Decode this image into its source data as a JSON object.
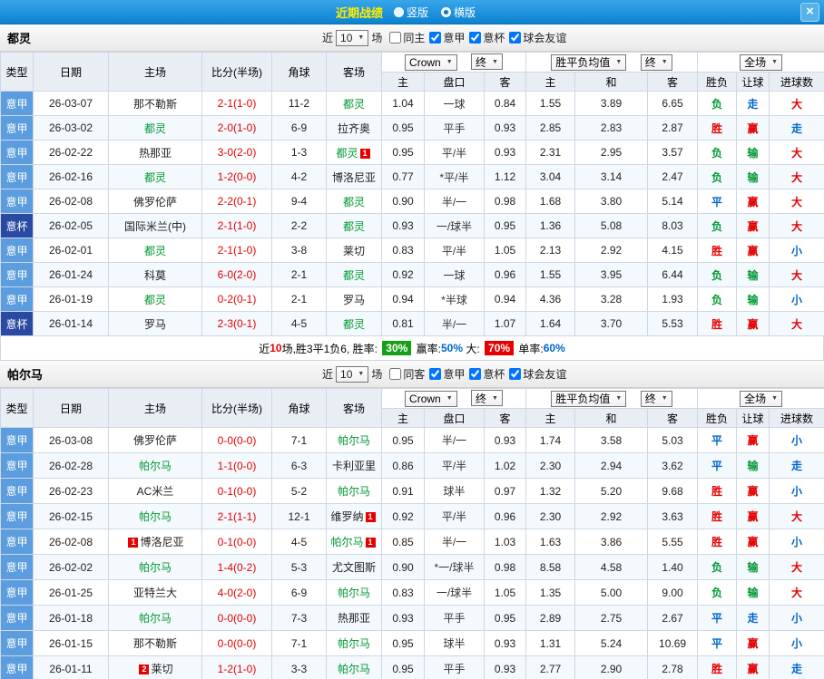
{
  "topbar": {
    "title": "近期战绩",
    "layout_options": [
      {
        "label": "竖版",
        "selected": false
      },
      {
        "label": "横版",
        "selected": true
      }
    ]
  },
  "icons": {
    "chevron_down": "▼",
    "close": "×"
  },
  "colors": {
    "league": {
      "意甲": "#5b9dde",
      "意杯": "#2a49a5"
    },
    "results": {
      "胜": "#e60000",
      "平": "#0066cc",
      "负": "#009933",
      "赢": "#e60000",
      "输": "#009933",
      "走": "#0066cc",
      "大": "#e60000",
      "小": "#0066cc"
    }
  },
  "table_headers": {
    "type": "类型",
    "date": "日期",
    "home": "主场",
    "score": "比分(半场)",
    "corner": "角球",
    "away": "客场",
    "odds_home": "主",
    "handicap": "盘口",
    "odds_away": "客",
    "avg_home": "主",
    "avg_draw": "和",
    "avg_away": "客",
    "result": "胜负",
    "handicap_result": "让球",
    "goals": "进球数",
    "bookmaker_select": "Crown",
    "final_select": "终",
    "avg_select": "胜平负均值",
    "scope_select": "全场"
  },
  "sections": [
    {
      "team": "都灵",
      "filter": {
        "recent_label": "近",
        "count": "10",
        "games_label": "场",
        "checkboxes": [
          {
            "label": "同主",
            "checked": false
          },
          {
            "label": "意甲",
            "checked": true
          },
          {
            "label": "意杯",
            "checked": true
          },
          {
            "label": "球会友谊",
            "checked": true
          }
        ]
      },
      "rows": [
        {
          "type": "意甲",
          "date": "26-03-07",
          "home": "那不勒斯",
          "score": "2-1(1-0)",
          "corner": "11-2",
          "away": "都灵",
          "odds": [
            "1.04",
            "一球",
            "0.84"
          ],
          "avg": [
            "1.55",
            "3.89",
            "6.65"
          ],
          "results": [
            "负",
            "走",
            "大"
          ]
        },
        {
          "type": "意甲",
          "date": "26-03-02",
          "home": "都灵",
          "score": "2-0(1-0)",
          "corner": "6-9",
          "away": "拉齐奥",
          "odds": [
            "0.95",
            "平手",
            "0.93"
          ],
          "avg": [
            "2.85",
            "2.83",
            "2.87"
          ],
          "results": [
            "胜",
            "赢",
            "走"
          ]
        },
        {
          "type": "意甲",
          "date": "26-02-22",
          "home": "热那亚",
          "score": "3-0(2-0)",
          "corner": "1-3",
          "away": "都灵",
          "away_card": "1",
          "odds": [
            "0.95",
            "平/半",
            "0.93"
          ],
          "avg": [
            "2.31",
            "2.95",
            "3.57"
          ],
          "results": [
            "负",
            "输",
            "大"
          ]
        },
        {
          "type": "意甲",
          "date": "26-02-16",
          "home": "都灵",
          "score": "1-2(0-0)",
          "corner": "4-2",
          "away": "博洛尼亚",
          "odds": [
            "0.77",
            "*平/半",
            "1.12"
          ],
          "avg": [
            "3.04",
            "3.14",
            "2.47"
          ],
          "results": [
            "负",
            "输",
            "大"
          ]
        },
        {
          "type": "意甲",
          "date": "26-02-08",
          "home": "佛罗伦萨",
          "score": "2-2(0-1)",
          "corner": "9-4",
          "away": "都灵",
          "odds": [
            "0.90",
            "半/一",
            "0.98"
          ],
          "avg": [
            "1.68",
            "3.80",
            "5.14"
          ],
          "results": [
            "平",
            "赢",
            "大"
          ]
        },
        {
          "type": "意杯",
          "date": "26-02-05",
          "home": "国际米兰(中)",
          "score": "2-1(1-0)",
          "corner": "2-2",
          "away": "都灵",
          "odds": [
            "0.93",
            "一/球半",
            "0.95"
          ],
          "avg": [
            "1.36",
            "5.08",
            "8.03"
          ],
          "results": [
            "负",
            "赢",
            "大"
          ]
        },
        {
          "type": "意甲",
          "date": "26-02-01",
          "home": "都灵",
          "score": "2-1(1-0)",
          "corner": "3-8",
          "away": "莱切",
          "odds": [
            "0.83",
            "平/半",
            "1.05"
          ],
          "avg": [
            "2.13",
            "2.92",
            "4.15"
          ],
          "results": [
            "胜",
            "赢",
            "小"
          ]
        },
        {
          "type": "意甲",
          "date": "26-01-24",
          "home": "科莫",
          "score": "6-0(2-0)",
          "corner": "2-1",
          "away": "都灵",
          "odds": [
            "0.92",
            "一球",
            "0.96"
          ],
          "avg": [
            "1.55",
            "3.95",
            "6.44"
          ],
          "results": [
            "负",
            "输",
            "大"
          ]
        },
        {
          "type": "意甲",
          "date": "26-01-19",
          "home": "都灵",
          "score": "0-2(0-1)",
          "corner": "2-1",
          "away": "罗马",
          "odds": [
            "0.94",
            "*半球",
            "0.94"
          ],
          "avg": [
            "4.36",
            "3.28",
            "1.93"
          ],
          "results": [
            "负",
            "输",
            "小"
          ]
        },
        {
          "type": "意杯",
          "date": "26-01-14",
          "home": "罗马",
          "score": "2-3(0-1)",
          "corner": "4-5",
          "away": "都灵",
          "odds": [
            "0.81",
            "半/一",
            "1.07"
          ],
          "avg": [
            "1.64",
            "3.70",
            "5.53"
          ],
          "results": [
            "胜",
            "赢",
            "大"
          ]
        }
      ],
      "summary_parts": [
        {
          "text": "近",
          "style": "plain"
        },
        {
          "text": "10",
          "style": "red-text"
        },
        {
          "text": "场,胜3平1负6, 胜率: ",
          "style": "plain"
        },
        {
          "text": "30%",
          "style": "green-badge"
        },
        {
          "text": " 赢率:",
          "style": "plain"
        },
        {
          "text": "50%",
          "style": "blue-text"
        },
        {
          "text": " 大: ",
          "style": "plain"
        },
        {
          "text": "70%",
          "style": "red-badge"
        },
        {
          "text": " 单率:",
          "style": "plain"
        },
        {
          "text": "60%",
          "style": "blue-text"
        }
      ]
    },
    {
      "team": "帕尔马",
      "filter": {
        "recent_label": "近",
        "count": "10",
        "games_label": "场",
        "checkboxes": [
          {
            "label": "同客",
            "checked": false
          },
          {
            "label": "意甲",
            "checked": true
          },
          {
            "label": "意杯",
            "checked": true
          },
          {
            "label": "球会友谊",
            "checked": true
          }
        ]
      },
      "rows": [
        {
          "type": "意甲",
          "date": "26-03-08",
          "home": "佛罗伦萨",
          "score": "0-0(0-0)",
          "corner": "7-1",
          "away": "帕尔马",
          "odds": [
            "0.95",
            "半/一",
            "0.93"
          ],
          "avg": [
            "1.74",
            "3.58",
            "5.03"
          ],
          "results": [
            "平",
            "赢",
            "小"
          ]
        },
        {
          "type": "意甲",
          "date": "26-02-28",
          "home": "帕尔马",
          "score": "1-1(0-0)",
          "corner": "6-3",
          "away": "卡利亚里",
          "odds": [
            "0.86",
            "平/半",
            "1.02"
          ],
          "avg": [
            "2.30",
            "2.94",
            "3.62"
          ],
          "results": [
            "平",
            "输",
            "走"
          ]
        },
        {
          "type": "意甲",
          "date": "26-02-23",
          "home": "AC米兰",
          "score": "0-1(0-0)",
          "corner": "5-2",
          "away": "帕尔马",
          "odds": [
            "0.91",
            "球半",
            "0.97"
          ],
          "avg": [
            "1.32",
            "5.20",
            "9.68"
          ],
          "results": [
            "胜",
            "赢",
            "小"
          ]
        },
        {
          "type": "意甲",
          "date": "26-02-15",
          "home": "帕尔马",
          "score": "2-1(1-1)",
          "corner": "12-1",
          "away": "维罗纳",
          "away_card": "1",
          "odds": [
            "0.92",
            "平/半",
            "0.96"
          ],
          "avg": [
            "2.30",
            "2.92",
            "3.63"
          ],
          "results": [
            "胜",
            "赢",
            "大"
          ]
        },
        {
          "type": "意甲",
          "date": "26-02-08",
          "home": "博洛尼亚",
          "home_card": "1",
          "score": "0-1(0-0)",
          "corner": "4-5",
          "away": "帕尔马",
          "away_card": "1",
          "odds": [
            "0.85",
            "半/一",
            "1.03"
          ],
          "avg": [
            "1.63",
            "3.86",
            "5.55"
          ],
          "results": [
            "胜",
            "赢",
            "小"
          ]
        },
        {
          "type": "意甲",
          "date": "26-02-02",
          "home": "帕尔马",
          "score": "1-4(0-2)",
          "corner": "5-3",
          "away": "尤文图斯",
          "odds": [
            "0.90",
            "*一/球半",
            "0.98"
          ],
          "avg": [
            "8.58",
            "4.58",
            "1.40"
          ],
          "results": [
            "负",
            "输",
            "大"
          ]
        },
        {
          "type": "意甲",
          "date": "26-01-25",
          "home": "亚特兰大",
          "score": "4-0(2-0)",
          "corner": "6-9",
          "away": "帕尔马",
          "odds": [
            "0.83",
            "一/球半",
            "1.05"
          ],
          "avg": [
            "1.35",
            "5.00",
            "9.00"
          ],
          "results": [
            "负",
            "输",
            "大"
          ]
        },
        {
          "type": "意甲",
          "date": "26-01-18",
          "home": "帕尔马",
          "score": "0-0(0-0)",
          "corner": "7-3",
          "away": "热那亚",
          "odds": [
            "0.93",
            "平手",
            "0.95"
          ],
          "avg": [
            "2.89",
            "2.75",
            "2.67"
          ],
          "results": [
            "平",
            "走",
            "小"
          ]
        },
        {
          "type": "意甲",
          "date": "26-01-15",
          "home": "那不勒斯",
          "score": "0-0(0-0)",
          "corner": "7-1",
          "away": "帕尔马",
          "odds": [
            "0.95",
            "球半",
            "0.93"
          ],
          "avg": [
            "1.31",
            "5.24",
            "10.69"
          ],
          "results": [
            "平",
            "赢",
            "小"
          ]
        },
        {
          "type": "意甲",
          "date": "26-01-11",
          "home": "莱切",
          "home_card": "2",
          "score": "1-2(1-0)",
          "corner": "3-3",
          "away": "帕尔马",
          "odds": [
            "0.95",
            "平手",
            "0.93"
          ],
          "avg": [
            "2.77",
            "2.90",
            "2.78"
          ],
          "results": [
            "胜",
            "赢",
            "走"
          ]
        }
      ]
    }
  ]
}
